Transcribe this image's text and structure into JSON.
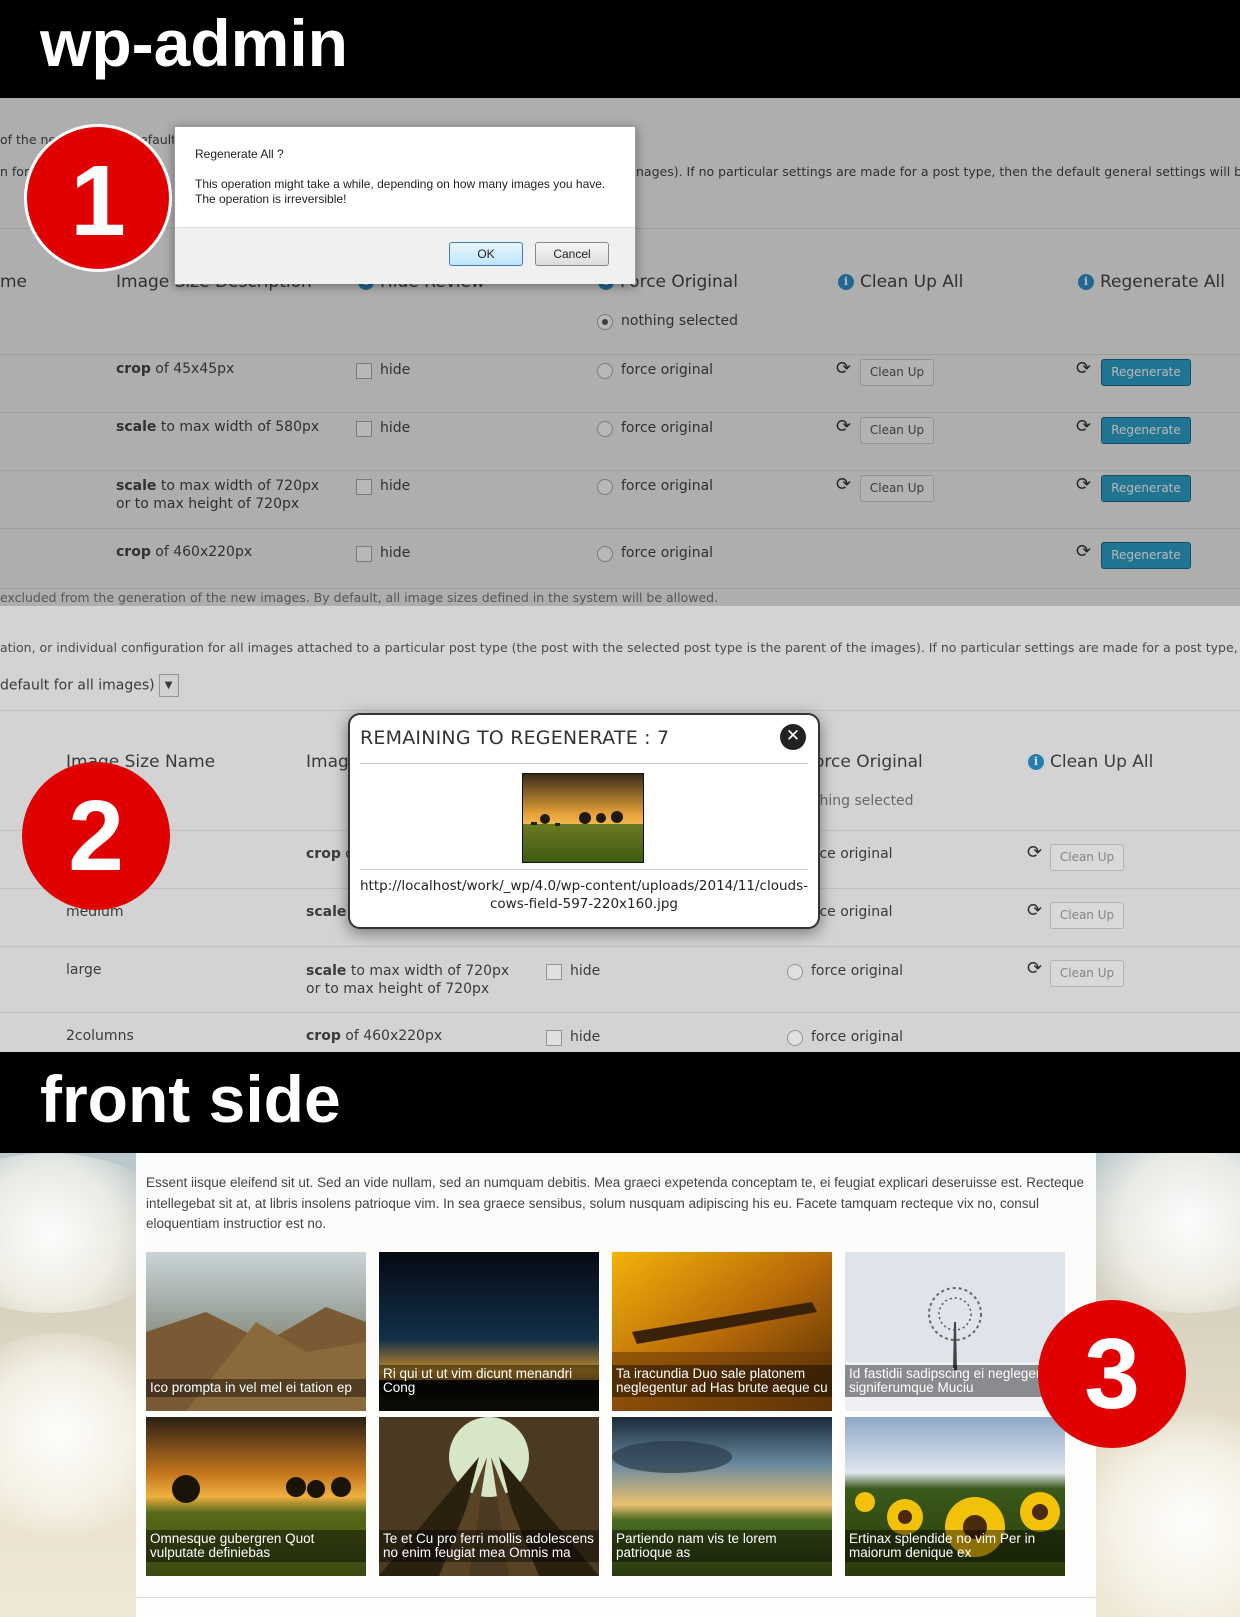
{
  "banners": {
    "admin": "wp-admin",
    "front": "front side"
  },
  "badges": [
    "1",
    "2",
    "3"
  ],
  "panel1": {
    "bg_texts": [
      "of the new",
      "efault, a",
      "n for a",
      "nages). If no particular settings are made for a post type, then the default general settings will be used.",
      "excluded from the generation of the new images. By default, all image sizes defined in the system will be allowed."
    ],
    "headers": {
      "name": "me",
      "description": "Image Size Description",
      "hide": "Hide Review",
      "force": "Force Original",
      "clean": "Clean Up All",
      "regen": "Regenerate All"
    },
    "nothing_selected": "nothing selected",
    "rows": [
      {
        "desc_bold": "crop",
        "desc_rest": " of 45x45px",
        "hide": "hide",
        "force": "force original",
        "clean": "Clean Up",
        "regen": "Regenerate"
      },
      {
        "desc_bold": "scale",
        "desc_rest": " to max width of 580px",
        "hide": "hide",
        "force": "force original",
        "clean": "Clean Up",
        "regen": "Regenerate"
      },
      {
        "desc_bold": "scale",
        "desc_rest": " to max width of 720px or to max height of 720px",
        "hide": "hide",
        "force": "force original",
        "clean": "Clean Up",
        "regen": "Regenerate"
      },
      {
        "desc_bold": "crop",
        "desc_rest": " of 460x220px",
        "hide": "hide",
        "force": "force original",
        "clean": "",
        "regen": "Regenerate"
      }
    ],
    "dialog": {
      "title": "Regenerate All ?",
      "line1": "This operation might take a while, depending on how many images you have.",
      "line2": "The operation is irreversible!",
      "ok": "OK",
      "cancel": "Cancel"
    }
  },
  "panel2": {
    "bg_text_top": "ation, or individual configuration for all images attached to a particular post type (the post with the selected post type is the parent of the images). If no particular settings are made for a post type, then the defa",
    "select_value": "default for all images)",
    "headers": {
      "name": "Image Size Name",
      "description": "Imag",
      "force": "orce Original",
      "clean": "Clean Up All"
    },
    "nothing_selected": "thing selected",
    "rows": [
      {
        "name": "",
        "desc_bold": "crop",
        "desc_rest": " o",
        "hide": "",
        "force": "rce original",
        "clean": "Clean Up"
      },
      {
        "name": "medium",
        "desc_bold": "scale",
        "desc_rest": " t",
        "hide": "",
        "force": "rce original",
        "clean": "Clean Up"
      },
      {
        "name": "large",
        "desc_bold": "scale",
        "desc_rest": " to max width of 720px or to max height of 720px",
        "hide": "hide",
        "force": "force original",
        "clean": "Clean Up"
      },
      {
        "name": "2columns",
        "desc_bold": "crop",
        "desc_rest": " of 460x220px",
        "hide": "hide",
        "force": "force original",
        "clean": ""
      }
    ],
    "modal": {
      "title": "REMAINING TO REGENERATE : 7",
      "url": "http://localhost/work/_wp/4.0/wp-content/uploads/2014/11/clouds-cows-field-597-220x160.jpg"
    }
  },
  "panel3": {
    "intro": "Essent iisque eleifend sit ut. Sed an vide nullam, sed an numquam debitis. Mea graeci expetenda conceptam te, ei feugiat explicari deseruisse est. Recteque intellegebat sit at, at libris insolens patrioque vim. In sea graece sensibus, solum nusquam adipiscing his eu. Facete tamquam recteque vix no, consul eloquentiam instructior est no.",
    "tiles": [
      {
        "caption": "Ico prompta in vel mel ei tation ep",
        "theme": "mountain"
      },
      {
        "caption": "Ri qui ut ut vim dicunt menandri Cong",
        "theme": "night"
      },
      {
        "caption": "Ta iracundia Duo sale platonem neglegentur ad Has brute aeque cu",
        "theme": "autumn"
      },
      {
        "caption": "Id fastidii sadipscing ei neglegentur signiferumque Muciu",
        "theme": "winter"
      },
      {
        "caption": "Omnesque gubergren Quot vulputate definiebas",
        "theme": "sunset"
      },
      {
        "caption": "Te et Cu pro ferri mollis adolescens no enim feugiat mea Omnis ma",
        "theme": "forest"
      },
      {
        "caption": "Partiendo nam vis te lorem patrioque as",
        "theme": "dusk"
      },
      {
        "caption": "Ertinax splendide no vim Per in maiorum denique ex",
        "theme": "sunflower"
      }
    ]
  },
  "colors": {
    "badge": "#e00000",
    "regen_button": "#2ea2cc",
    "info_icon": "#2e8fc9"
  }
}
